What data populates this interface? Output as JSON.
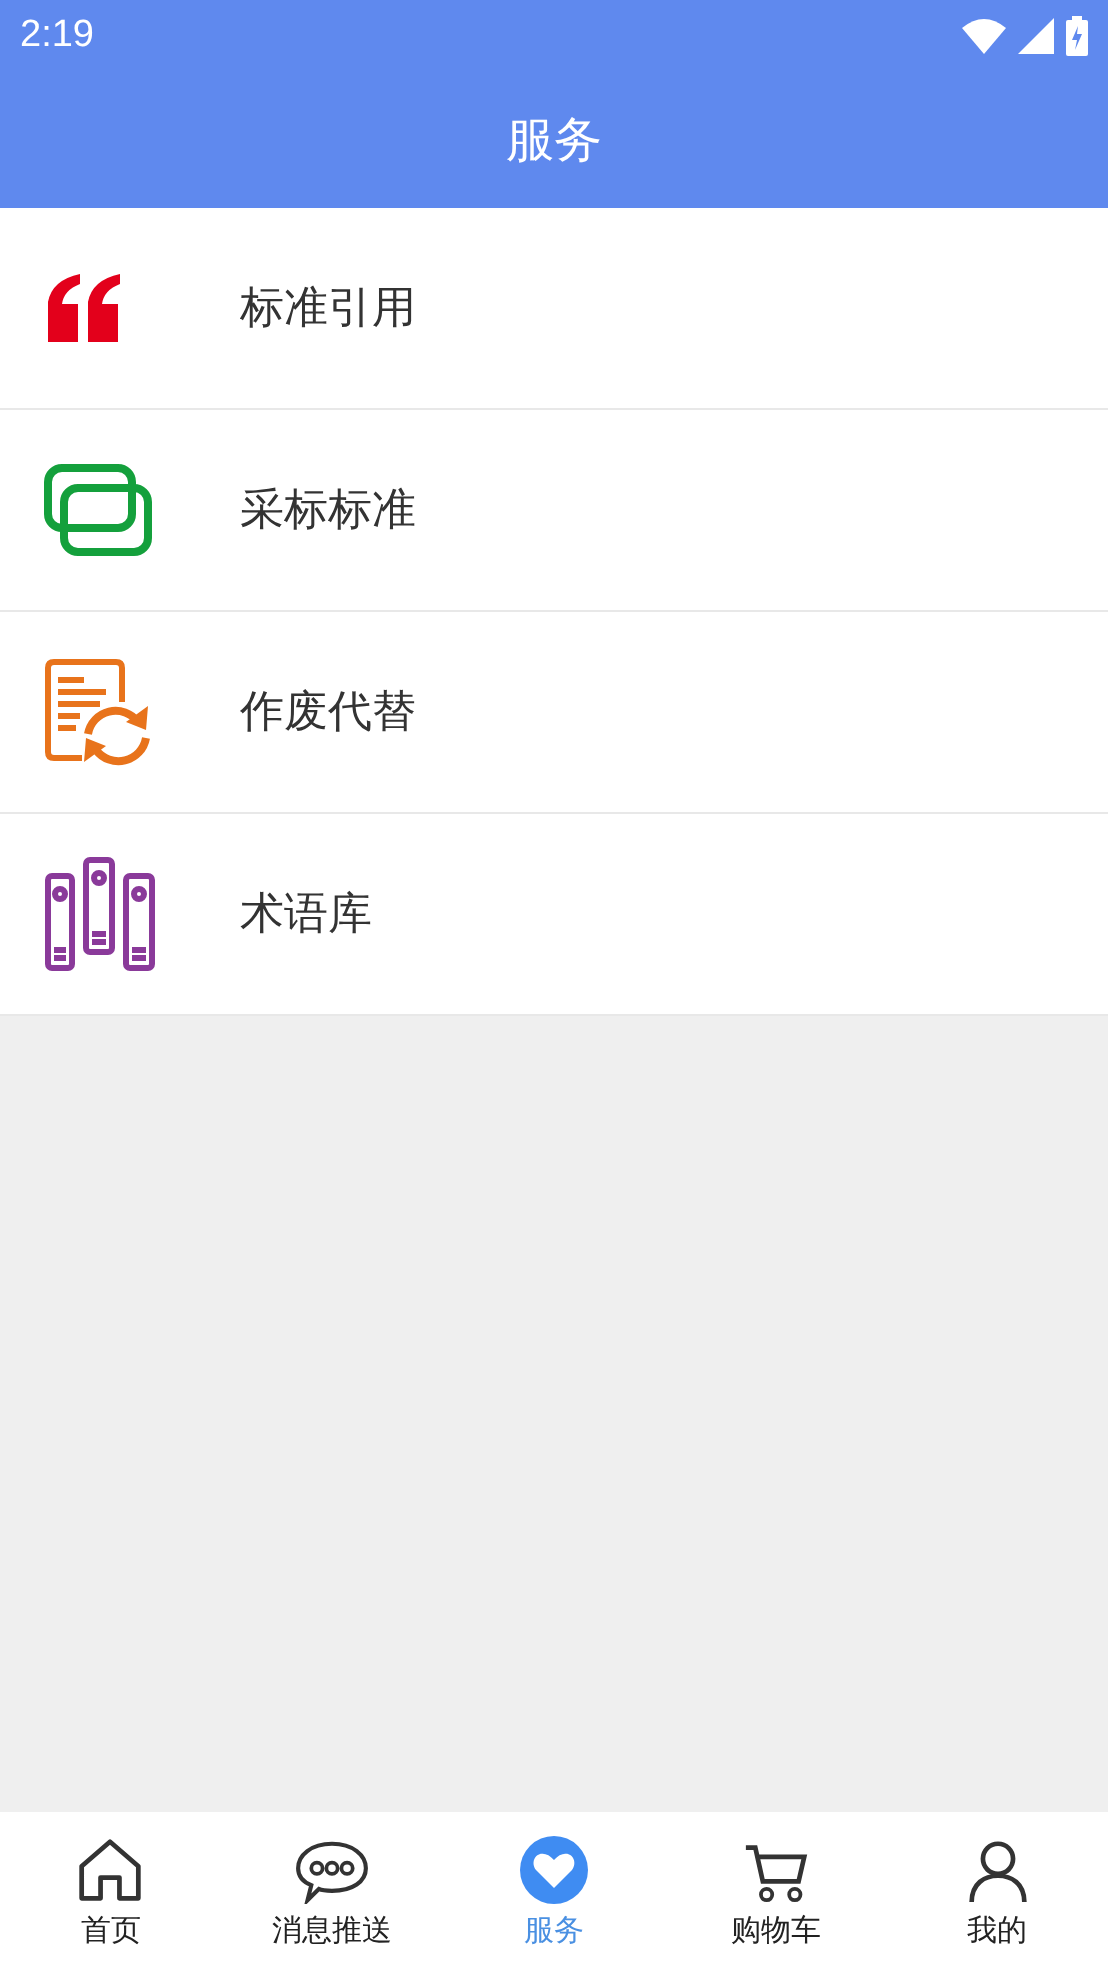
{
  "status_bar": {
    "time": "2:19"
  },
  "header": {
    "title": "服务"
  },
  "services": [
    {
      "kind": "quote",
      "label": "标准引用"
    },
    {
      "kind": "frames",
      "label": "采标标准"
    },
    {
      "kind": "document",
      "label": "作废代替"
    },
    {
      "kind": "books",
      "label": "术语库"
    }
  ],
  "bottom_nav": [
    {
      "kind": "home",
      "label": "首页",
      "selected": false
    },
    {
      "kind": "chat",
      "label": "消息推送",
      "selected": false
    },
    {
      "kind": "heart",
      "label": "服务",
      "selected": true
    },
    {
      "kind": "cart",
      "label": "购物车",
      "selected": false
    },
    {
      "kind": "person",
      "label": "我的",
      "selected": false
    }
  ]
}
